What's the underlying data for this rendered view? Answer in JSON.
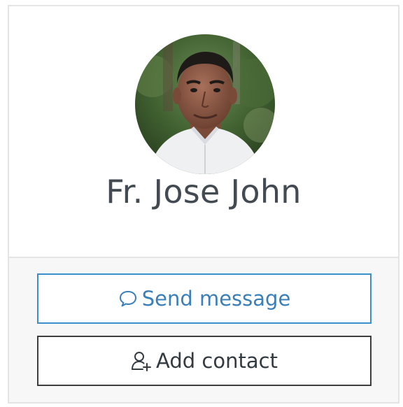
{
  "profile": {
    "name": "Fr. Jose John",
    "avatar_icon": "profile-photo"
  },
  "actions": {
    "send_message_label": "Send message",
    "send_message_icon": "speech-bubble-icon",
    "add_contact_label": "Add contact",
    "add_contact_icon": "user-add-icon"
  },
  "colors": {
    "primary_border": "#3c8fcb",
    "primary_text": "#3a7fb8",
    "secondary_border": "#3d3d3d",
    "name_text": "#434a52"
  }
}
